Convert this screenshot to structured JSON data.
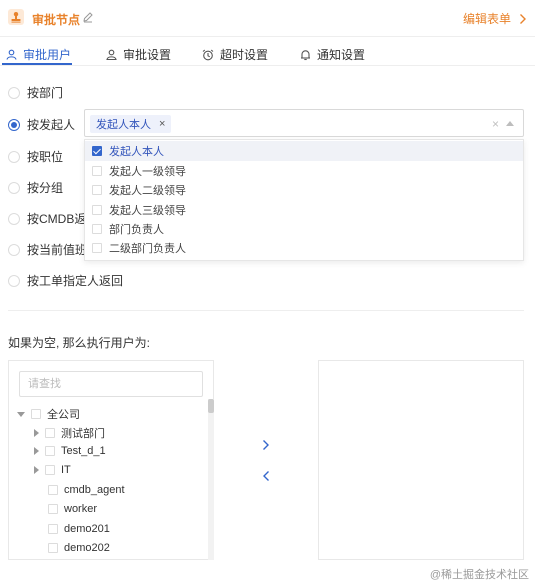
{
  "header": {
    "title": "审批节点",
    "edit_form": "编辑表单"
  },
  "tabs": [
    {
      "label": "审批用户",
      "icon": "user-icon"
    },
    {
      "label": "审批设置",
      "icon": "user-settings-icon"
    },
    {
      "label": "超时设置",
      "icon": "alarm-clock-icon"
    },
    {
      "label": "通知设置",
      "icon": "bell-icon"
    }
  ],
  "radios": [
    {
      "label": "按部门",
      "checked": false
    },
    {
      "label": "按发起人",
      "checked": true
    },
    {
      "label": "按职位",
      "checked": false
    },
    {
      "label": "按分组",
      "checked": false
    },
    {
      "label": "按CMDB返回",
      "checked": false
    },
    {
      "label": "按当前值班",
      "checked": false
    },
    {
      "label": "按工单指定人返回",
      "checked": false
    }
  ],
  "select": {
    "tag": "发起人本人",
    "tag_close": "×",
    "clear": "×"
  },
  "options": [
    {
      "label": "发起人本人",
      "checked": true
    },
    {
      "label": "发起人一级领导",
      "checked": false
    },
    {
      "label": "发起人二级领导",
      "checked": false
    },
    {
      "label": "发起人三级领导",
      "checked": false
    },
    {
      "label": "部门负责人",
      "checked": false
    },
    {
      "label": "二级部门负责人",
      "checked": false
    }
  ],
  "empty_label": "如果为空, 那么执行用户为:",
  "transfer": {
    "search_placeholder": "请查找",
    "tree": [
      {
        "label": "全公司",
        "expander": "down"
      },
      {
        "label": "测试部门",
        "expander": "right"
      },
      {
        "label": "Test_d_1",
        "expander": "right"
      },
      {
        "label": "IT",
        "expander": "right"
      },
      {
        "label": "cmdb_agent",
        "expander": "none"
      },
      {
        "label": "worker",
        "expander": "none"
      },
      {
        "label": "demo201",
        "expander": "none"
      },
      {
        "label": "demo202",
        "expander": "none"
      }
    ]
  },
  "watermark": "@稀土掘金技术社区",
  "colors": {
    "accent_orange": "#e8822b",
    "primary_blue": "#3366cc"
  }
}
